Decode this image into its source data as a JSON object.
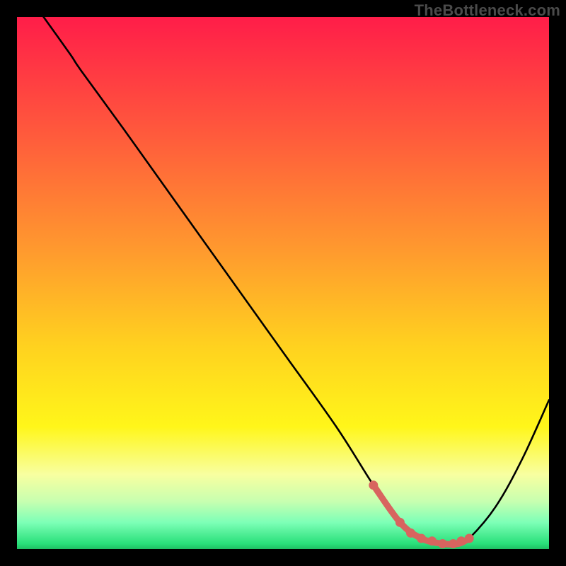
{
  "watermark": "TheBottleneck.com",
  "chart_data": {
    "type": "line",
    "title": "",
    "xlabel": "",
    "ylabel": "",
    "xlim": [
      0,
      100
    ],
    "ylim": [
      0,
      100
    ],
    "series": [
      {
        "name": "curve",
        "x": [
          5,
          10,
          12,
          20,
          30,
          40,
          50,
          60,
          67,
          72,
          76,
          80,
          83,
          85,
          90,
          95,
          100
        ],
        "y": [
          100,
          93,
          90,
          79,
          65,
          51,
          37,
          23,
          12,
          5,
          2,
          1,
          1,
          2,
          8,
          17,
          28
        ]
      },
      {
        "name": "trough-highlight",
        "x": [
          67,
          72,
          76,
          80,
          83,
          85
        ],
        "y": [
          12,
          5,
          2,
          1,
          1,
          2
        ]
      }
    ],
    "trough_points": [
      {
        "x": 67,
        "y": 12
      },
      {
        "x": 72,
        "y": 5
      },
      {
        "x": 74,
        "y": 3
      },
      {
        "x": 76,
        "y": 2
      },
      {
        "x": 78,
        "y": 1.5
      },
      {
        "x": 80,
        "y": 1
      },
      {
        "x": 82,
        "y": 1
      },
      {
        "x": 83.5,
        "y": 1.5
      },
      {
        "x": 85,
        "y": 2
      }
    ],
    "colors": {
      "curve": "#000000",
      "highlight": "#d8645f",
      "gradient_top": "#ff1d49",
      "gradient_bottom": "#1fc063"
    }
  }
}
